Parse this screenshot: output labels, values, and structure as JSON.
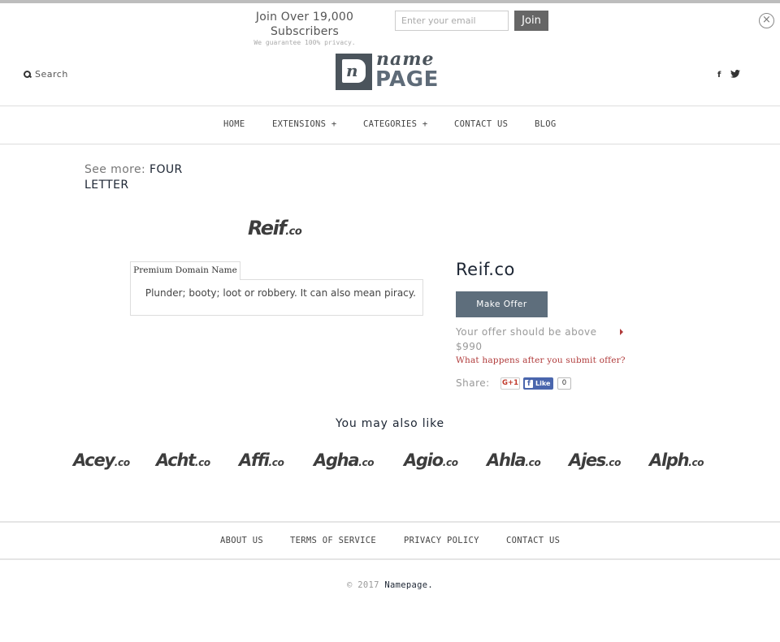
{
  "newsletter": {
    "title": "Join Over 19,000 Subscribers",
    "subtitle": "We guarantee 100% privacy.",
    "email_placeholder": "Enter your email",
    "email_value": "",
    "join_label": "Join",
    "close_icon": "×"
  },
  "header": {
    "search_label": "Search",
    "logo_name": "name",
    "logo_page": "PAGE",
    "logo_mark": "n",
    "social": {
      "facebook": "f",
      "twitter": "🐦"
    }
  },
  "nav": {
    "items": [
      {
        "label": "HOME"
      },
      {
        "label": "EXTENSIONS +"
      },
      {
        "label": "CATEGORIES +"
      },
      {
        "label": "CONTACT US"
      },
      {
        "label": "BLOG"
      }
    ]
  },
  "see_more": {
    "label": "See more:",
    "value": "FOUR LETTER"
  },
  "domain": {
    "logo_main": "Reif",
    "logo_tld": ".co",
    "name": "Reif.co",
    "tab_label": "Premium Domain Name",
    "description": "Plunder; booty; loot or robbery. It can also mean piracy.",
    "make_offer_label": "Make Offer",
    "offer_note": "Your offer should be above $990",
    "what_happens_link": "What happens after you submit offer?",
    "share_label": "Share:",
    "gplus_label": "G+1",
    "fb_like_label": "Like",
    "fb_icon": "f",
    "fb_count": "0"
  },
  "also_like": {
    "title": "You may also like",
    "items": [
      {
        "main": "Acey",
        "tld": ".co"
      },
      {
        "main": "Acht",
        "tld": ".co"
      },
      {
        "main": "Affi",
        "tld": ".co"
      },
      {
        "main": "Agha",
        "tld": ".co"
      },
      {
        "main": "Agio",
        "tld": ".co"
      },
      {
        "main": "Ahla",
        "tld": ".co"
      },
      {
        "main": "Ajes",
        "tld": ".co"
      },
      {
        "main": "Alph",
        "tld": ".co"
      }
    ]
  },
  "footer": {
    "items": [
      {
        "label": "ABOUT US"
      },
      {
        "label": "TERMS OF SERVICE"
      },
      {
        "label": "PRIVACY POLICY"
      },
      {
        "label": "CONTACT US"
      }
    ],
    "copyright": "© 2017",
    "brand": "Namepage."
  }
}
